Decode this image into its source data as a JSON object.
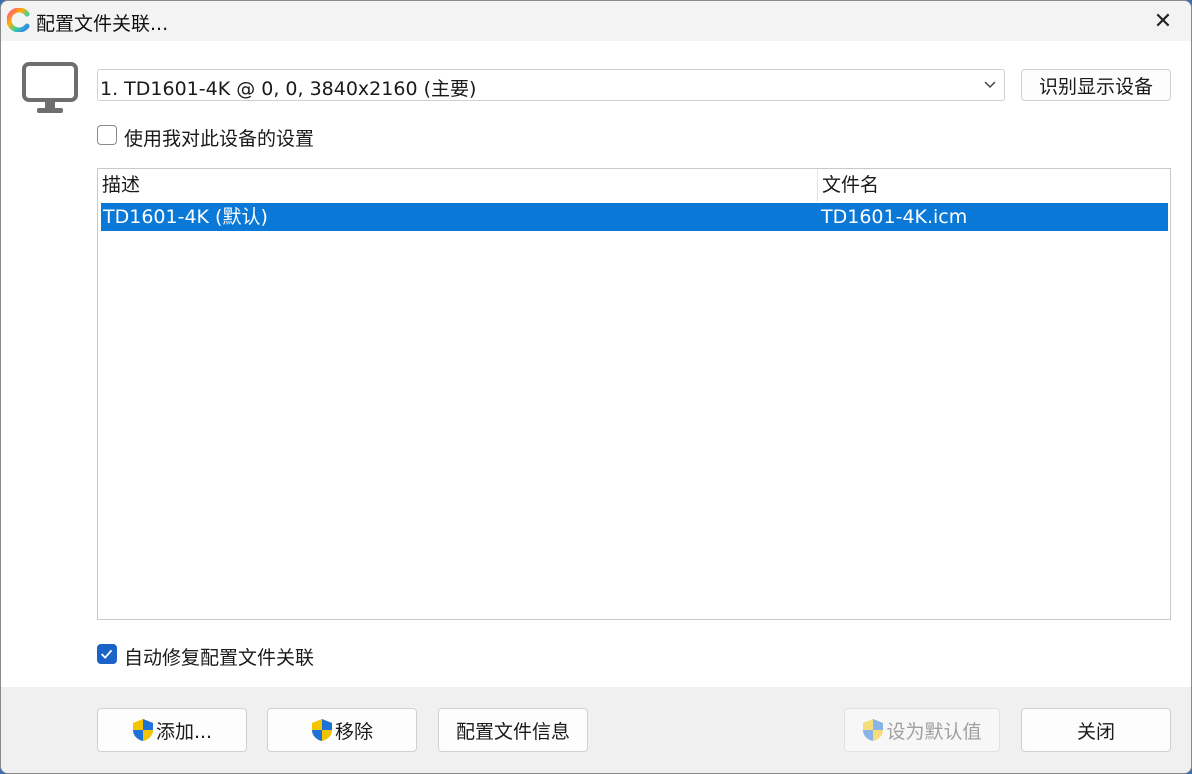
{
  "window": {
    "title": "配置文件关联...",
    "close_glyph": "✕"
  },
  "device": {
    "selected": "1. TD1601-4K @ 0, 0, 3840x2160 (主要)",
    "identify_label": "识别显示设备"
  },
  "use_my_settings": {
    "label": "使用我对此设备的设置",
    "checked": false
  },
  "profile_list": {
    "columns": [
      "描述",
      "文件名"
    ],
    "rows": [
      {
        "description": "TD1601-4K (默认)",
        "filename": "TD1601-4K.icm",
        "selected": true
      }
    ]
  },
  "auto_repair": {
    "label": "自动修复配置文件关联",
    "checked": true
  },
  "buttons": {
    "add": "添加...",
    "remove": "移除",
    "profile_info": "配置文件信息",
    "set_default": "设为默认值",
    "close": "关闭"
  },
  "colors": {
    "selection": "#0a78d7",
    "checkbox_checked": "#1b63c6"
  }
}
